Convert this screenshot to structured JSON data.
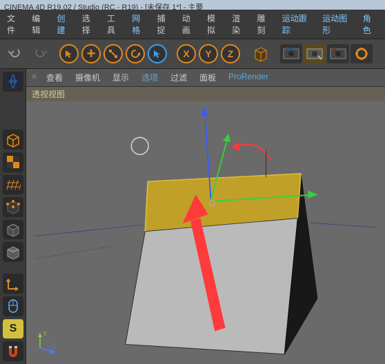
{
  "titlebar": {
    "text": "CINEMA 4D R19.02 / Studio (RC - R19) - [未保存 1*] - 主要"
  },
  "menu": {
    "file": "文件",
    "edit": "编辑",
    "create": "创建",
    "select": "选择",
    "tools": "工具",
    "mesh": "网格",
    "capture": "捕捉",
    "animate": "动画",
    "simulate": "模拟",
    "render": "渲染",
    "sculpt": "雕刻",
    "motiontrack": "运动跟踪",
    "motiongfx": "运动图形",
    "character": "角色"
  },
  "axis": {
    "x": "X",
    "y": "Y",
    "z": "Z"
  },
  "viewmenu": {
    "view": "查看",
    "camera": "摄像机",
    "display": "显示",
    "options": "选项",
    "filter": "过滤",
    "panel": "面板",
    "prorender": "ProRender"
  },
  "viewtitle": "透视视图",
  "axis_ind": {
    "y": "Y",
    "z": "Z"
  }
}
